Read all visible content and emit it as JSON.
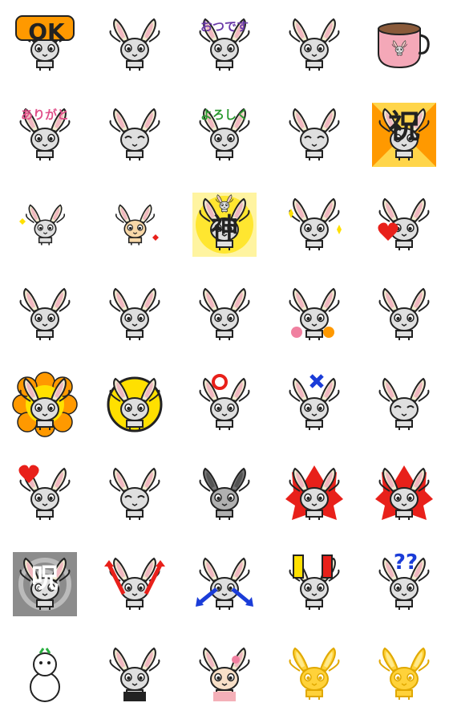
{
  "sheet": {
    "stickers": [
      {
        "id": "ok",
        "text": "OK"
      },
      {
        "id": "wave",
        "text": ""
      },
      {
        "id": "otsukare",
        "text": "おつです"
      },
      {
        "id": "hold",
        "text": ""
      },
      {
        "id": "cup",
        "text": ""
      },
      {
        "id": "arigato",
        "text": "ありがと"
      },
      {
        "id": "pray",
        "text": ""
      },
      {
        "id": "yoroshiku",
        "text": "よろしく"
      },
      {
        "id": "smile",
        "text": ""
      },
      {
        "id": "iwai",
        "text": "祝"
      },
      {
        "id": "small-yellow",
        "text": ""
      },
      {
        "id": "small-orange",
        "text": ""
      },
      {
        "id": "kami",
        "text": "神"
      },
      {
        "id": "sparkle",
        "text": ""
      },
      {
        "id": "heart",
        "text": ""
      },
      {
        "id": "plain",
        "text": ""
      },
      {
        "id": "open-arms",
        "text": ""
      },
      {
        "id": "point",
        "text": ""
      },
      {
        "id": "flowers",
        "text": ""
      },
      {
        "id": "star",
        "text": ""
      },
      {
        "id": "flower-bg",
        "text": ""
      },
      {
        "id": "sun-circle",
        "text": ""
      },
      {
        "id": "maru",
        "text": "○"
      },
      {
        "id": "batsu",
        "text": "✕"
      },
      {
        "id": "sulk",
        "text": ""
      },
      {
        "id": "broken-heart",
        "text": ""
      },
      {
        "id": "sad",
        "text": ""
      },
      {
        "id": "gray",
        "text": ""
      },
      {
        "id": "fire",
        "text": ""
      },
      {
        "id": "angry-fire",
        "text": ""
      },
      {
        "id": "noroi",
        "text": "呪"
      },
      {
        "id": "arrows-up",
        "text": ""
      },
      {
        "id": "arrows-down",
        "text": ""
      },
      {
        "id": "exclaim",
        "text": "!!"
      },
      {
        "id": "question",
        "text": "??"
      },
      {
        "id": "snowman",
        "text": ""
      },
      {
        "id": "graduation",
        "text": ""
      },
      {
        "id": "kimono",
        "text": ""
      },
      {
        "id": "gold-1",
        "text": ""
      },
      {
        "id": "gold-2",
        "text": ""
      }
    ]
  },
  "colors": {
    "outline": "#222222",
    "body": "#dfdfdf",
    "ear_inner": "#f0b8c0",
    "ear_outer": "#f2ecd0",
    "orange": "#ff9900",
    "yellow": "#ffe000",
    "pink": "#f080a0",
    "red": "#e8201a",
    "blue": "#1a3cd8",
    "green": "#2ab040",
    "gold": "#ffd23a",
    "purple": "#6a3aa8"
  }
}
